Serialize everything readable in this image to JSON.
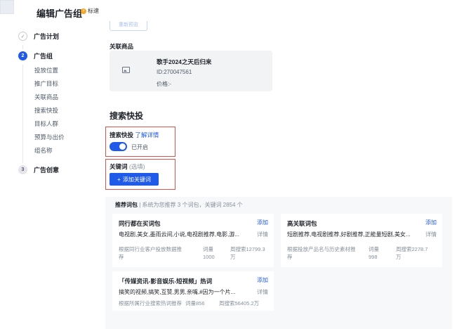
{
  "header": {
    "title": "编辑广告组",
    "badge": "标速"
  },
  "sidebar": {
    "steps": [
      {
        "number": "✓",
        "label": "广告计划"
      },
      {
        "number": "2",
        "label": "广告组"
      },
      {
        "number": "3",
        "label": "广告创意"
      }
    ],
    "substeps": [
      "投放位置",
      "推广目标",
      "关联商品",
      "搜索快投",
      "目标人群",
      "预算与出价",
      "组名称"
    ]
  },
  "main": {
    "ghost_button": "重新预览",
    "related_products_label": "关联商品",
    "product": {
      "name": "歌手2024之天后归来",
      "id": "ID:270047561",
      "price": "价格:-"
    },
    "search_section_title": "搜索快投",
    "search_quick": {
      "label": "搜索快投",
      "learn_more": "了解详情",
      "toggle_state": "已开启",
      "enabled": true
    },
    "keywords": {
      "label": "关键词",
      "optional": "(选填)",
      "add_button": "添加关键词",
      "add_icon": "+"
    },
    "recommend": {
      "title": "推荐词包",
      "separator": "|",
      "meta": "系统为您推荐 3 个词包，关键词 2854 个",
      "packages": [
        {
          "name": "同行都在买词包",
          "add": "添加",
          "words": "电视剧,美女,墨雨云间,小说,电视剧推荐,电影,游...",
          "detail": "详情",
          "desc_line1": "根据同行业客户投放数据推",
          "desc_line2": "荐",
          "count_line1": "词量",
          "count_line2": "1000",
          "search_line1": "周搜索12799.3",
          "search_line2": "万"
        },
        {
          "name": "高关联词包",
          "add": "添加",
          "words": "短剧推荐,电视剧推荐,好剧推荐,正能量短剧,美女...",
          "detail": "详情",
          "desc_line1": "根据投放产品名与历史素材推",
          "desc_line2": "荐",
          "count_line1": "词量",
          "count_line2": "998",
          "search_line1": "周搜索2278.7",
          "search_line2": "万"
        },
        {
          "name": "「传媒资讯-影音娱乐-短视频」热词",
          "add": "添加",
          "words": "搞笑的视频,搞笑,互赞,男男,亲嘴,#因为一个片...",
          "detail": "详情",
          "desc_line1": "根据所属行业搜索热词推荐",
          "count_line1": "词量856",
          "search_line1": "周搜索56405.2万"
        }
      ]
    }
  },
  "colors": {
    "accent": "#1f5ae8",
    "highlight_border": "#d9534f"
  }
}
